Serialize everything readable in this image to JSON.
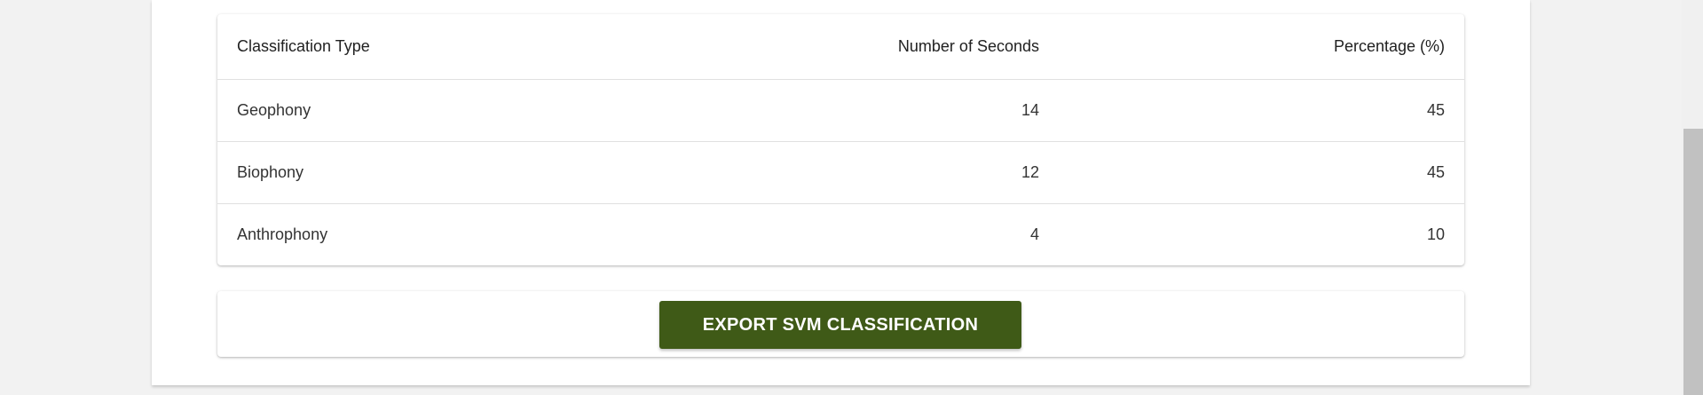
{
  "table": {
    "headers": {
      "type": "Classification Type",
      "seconds": "Number of Seconds",
      "percentage": "Percentage (%)"
    },
    "rows": [
      {
        "type": "Geophony",
        "seconds": "14",
        "percentage": "45"
      },
      {
        "type": "Biophony",
        "seconds": "12",
        "percentage": "45"
      },
      {
        "type": "Anthrophony",
        "seconds": "4",
        "percentage": "10"
      }
    ]
  },
  "actions": {
    "export_label": "EXPORT SVM CLASSIFICATION",
    "export_color": "#3f5a17"
  }
}
